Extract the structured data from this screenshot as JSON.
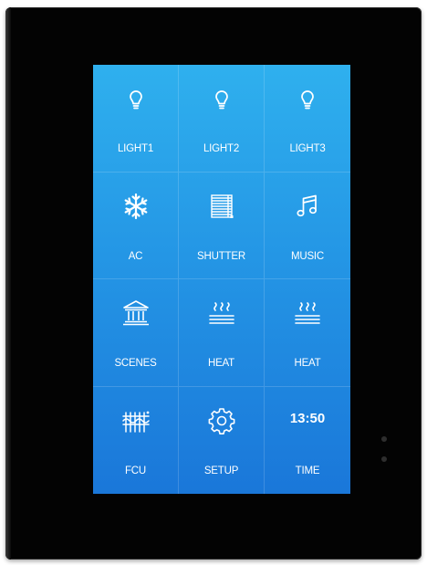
{
  "panel": {
    "tiles": [
      {
        "label": "LIGHT1",
        "icon": "light-bulb-icon"
      },
      {
        "label": "LIGHT2",
        "icon": "light-bulb-icon"
      },
      {
        "label": "LIGHT3",
        "icon": "light-bulb-icon"
      },
      {
        "label": "AC",
        "icon": "snowflake-icon"
      },
      {
        "label": "SHUTTER",
        "icon": "shutter-icon"
      },
      {
        "label": "MUSIC",
        "icon": "music-note-icon"
      },
      {
        "label": "SCENES",
        "icon": "building-icon"
      },
      {
        "label": "HEAT",
        "icon": "heating-icon"
      },
      {
        "label": "HEAT",
        "icon": "heating-icon"
      },
      {
        "label": "FCU",
        "icon": "fan-coil-icon"
      },
      {
        "label": "SETUP",
        "icon": "gear-icon"
      },
      {
        "label": "TIME",
        "icon": "clock-text",
        "value": "13:50"
      }
    ]
  },
  "colors": {
    "screen_top": "#2fb0ee",
    "screen_bottom": "#1a77d9",
    "bezel": "#030303",
    "icon": "#ffffff"
  }
}
